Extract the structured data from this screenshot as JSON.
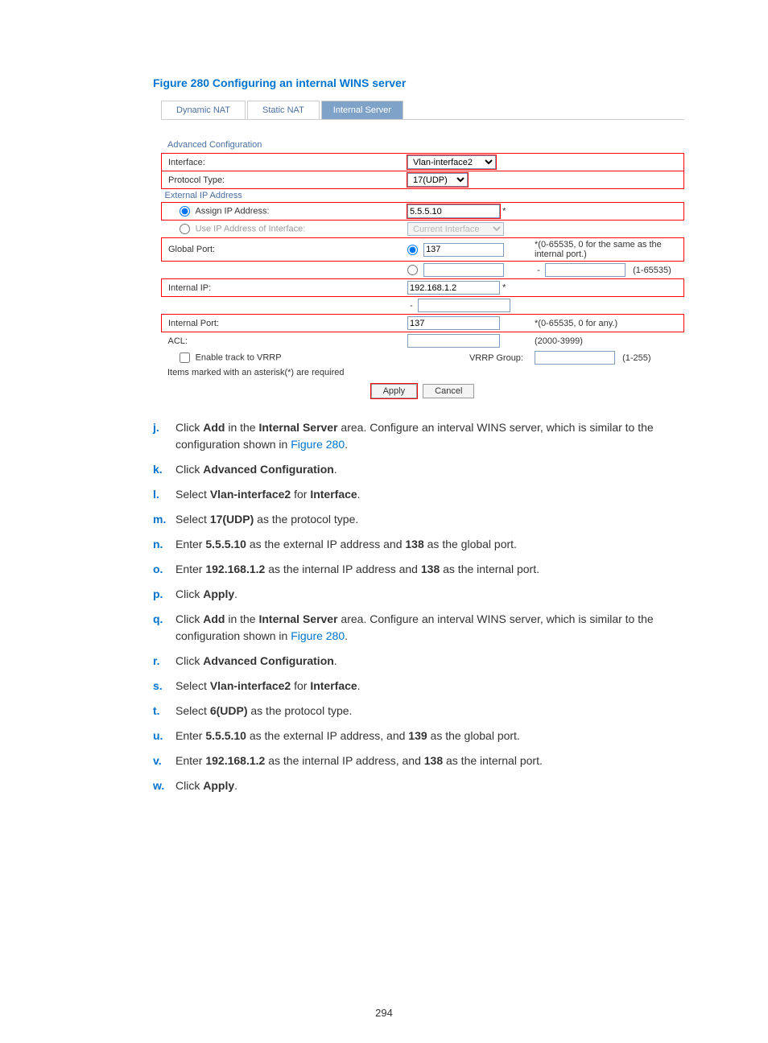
{
  "figure_caption": "Figure 280 Configuring an internal WINS server",
  "tabs": [
    "Dynamic NAT",
    "Static NAT",
    "Internal Server"
  ],
  "section_link": "Advanced Configuration",
  "form": {
    "interface_label": "Interface:",
    "interface_value": "Vlan-interface2",
    "protocol_label": "Protocol Type:",
    "protocol_value": "17(UDP)",
    "external_ip_header": "External IP Address",
    "assign_ip_label": "Assign IP Address:",
    "assign_ip_value": "5.5.5.10",
    "use_if_label": "Use IP Address of Interface:",
    "use_if_value": "Current Interface",
    "global_port_label": "Global Port:",
    "global_port_value": "137",
    "global_port_hint": "*(0-65535, 0 for the same as the internal port.)",
    "global_port_range_hint": "(1-65535)",
    "internal_ip_label": "Internal IP:",
    "internal_ip_value": "192.168.1.2",
    "internal_port_label": "Internal Port:",
    "internal_port_value": "137",
    "internal_port_hint": "*(0-65535, 0 for any.)",
    "acl_label": "ACL:",
    "acl_hint": "(2000-3999)",
    "vrrp_check_label": "Enable track to VRRP",
    "vrrp_group_label": "VRRP Group:",
    "vrrp_group_hint": "(1-255)",
    "required_note": "Items marked with an asterisk(*) are required",
    "apply_btn": "Apply",
    "cancel_btn": "Cancel",
    "asterisk": "*",
    "dash": "-"
  },
  "steps": [
    {
      "letter": "j.",
      "parts": [
        "Click ",
        [
          "b",
          "Add"
        ],
        " in the ",
        [
          "b",
          "Internal Server"
        ],
        " area. Configure an interval WINS server, which is similar to the configuration shown in ",
        [
          "link",
          "Figure 280"
        ],
        "."
      ]
    },
    {
      "letter": "k.",
      "parts": [
        "Click ",
        [
          "b",
          "Advanced Configuration"
        ],
        "."
      ]
    },
    {
      "letter": "l.",
      "parts": [
        "Select ",
        [
          "b",
          "Vlan-interface2"
        ],
        " for ",
        [
          "b",
          "Interface"
        ],
        "."
      ]
    },
    {
      "letter": "m.",
      "parts": [
        "Select ",
        [
          "b",
          "17(UDP)"
        ],
        " as the protocol type."
      ]
    },
    {
      "letter": "n.",
      "parts": [
        "Enter ",
        [
          "b",
          "5.5.5.10"
        ],
        " as the external IP address and ",
        [
          "b",
          "138"
        ],
        " as the global port."
      ]
    },
    {
      "letter": "o.",
      "parts": [
        "Enter ",
        [
          "b",
          "192.168.1.2"
        ],
        " as the internal IP address and ",
        [
          "b",
          "138"
        ],
        " as the internal port."
      ]
    },
    {
      "letter": "p.",
      "parts": [
        "Click ",
        [
          "b",
          "Apply"
        ],
        "."
      ]
    },
    {
      "letter": "q.",
      "parts": [
        "Click ",
        [
          "b",
          "Add"
        ],
        " in the ",
        [
          "b",
          "Internal Server"
        ],
        " area. Configure an interval WINS server, which is similar to the configuration shown in ",
        [
          "link",
          "Figure 280"
        ],
        "."
      ]
    },
    {
      "letter": "r.",
      "parts": [
        "Click ",
        [
          "b",
          "Advanced Configuration"
        ],
        "."
      ]
    },
    {
      "letter": "s.",
      "parts": [
        "Select ",
        [
          "b",
          "Vlan-interface2"
        ],
        " for ",
        [
          "b",
          "Interface"
        ],
        "."
      ]
    },
    {
      "letter": "t.",
      "parts": [
        "Select ",
        [
          "b",
          "6(UDP)"
        ],
        " as the protocol type."
      ]
    },
    {
      "letter": "u.",
      "parts": [
        "Enter ",
        [
          "b",
          "5.5.5.10"
        ],
        " as the external IP address, and ",
        [
          "b",
          "139"
        ],
        " as the global port."
      ]
    },
    {
      "letter": "v.",
      "parts": [
        "Enter ",
        [
          "b",
          "192.168.1.2"
        ],
        " as the internal IP address, and ",
        [
          "b",
          "138"
        ],
        " as the internal port."
      ]
    },
    {
      "letter": "w.",
      "parts": [
        "Click ",
        [
          "b",
          "Apply"
        ],
        "."
      ]
    }
  ],
  "page_number": "294"
}
